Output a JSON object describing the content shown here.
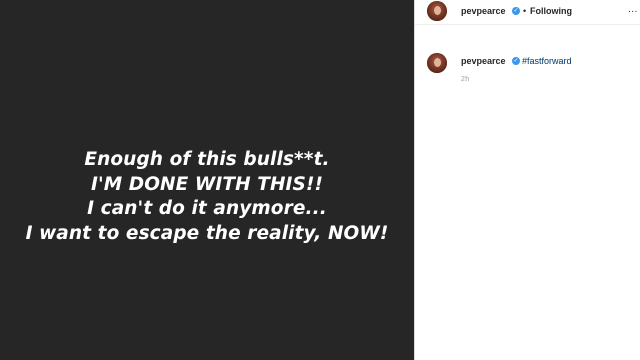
{
  "post": {
    "caption_lines": [
      "Enough of this bulls**t.",
      "I'M DONE WITH THIS!!",
      "I can't do it anymore...",
      "I want to escape the reality, NOW!"
    ]
  },
  "header": {
    "username": "pevpearce",
    "separator": "•",
    "follow_label": "Following",
    "more_label": "..."
  },
  "comment": {
    "username": "pevpearce",
    "hashtag": "#fastforward",
    "time": "2h"
  },
  "icons": {
    "verified": "verified-badge-icon",
    "avatar": "profile-photo"
  },
  "colors": {
    "media_bg": "#262626",
    "verified_blue": "#3897f0",
    "hashtag": "#003569",
    "muted": "#999999"
  }
}
